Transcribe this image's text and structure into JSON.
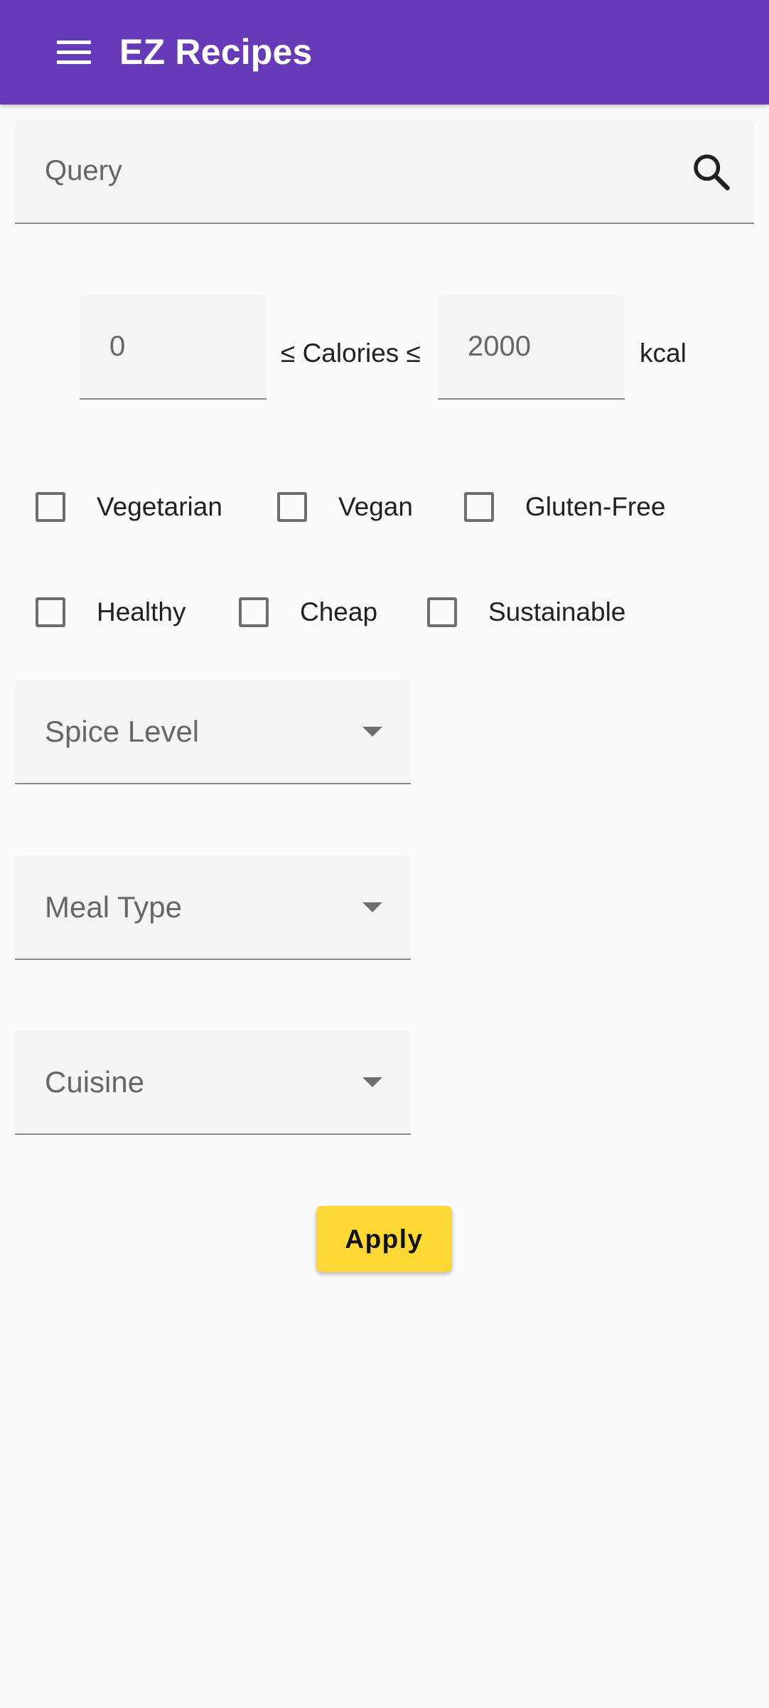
{
  "app_bar": {
    "title": "EZ Recipes",
    "menu_icon": "menu-icon",
    "background_color": "#673ab7"
  },
  "search": {
    "placeholder": "Query",
    "icon": "search-icon"
  },
  "calories": {
    "min_value": "0",
    "max_placeholder": "2000",
    "label": "≤ Calories ≤",
    "unit": "kcal"
  },
  "filters": {
    "row1": [
      "Vegetarian",
      "Vegan",
      "Gluten-Free"
    ],
    "row2": [
      "Healthy",
      "Cheap",
      "Sustainable"
    ]
  },
  "selects": {
    "spice_level": "Spice Level",
    "meal_type": "Meal Type",
    "cuisine": "Cuisine"
  },
  "apply_button": {
    "label": "Apply",
    "color": "#fdd835"
  }
}
